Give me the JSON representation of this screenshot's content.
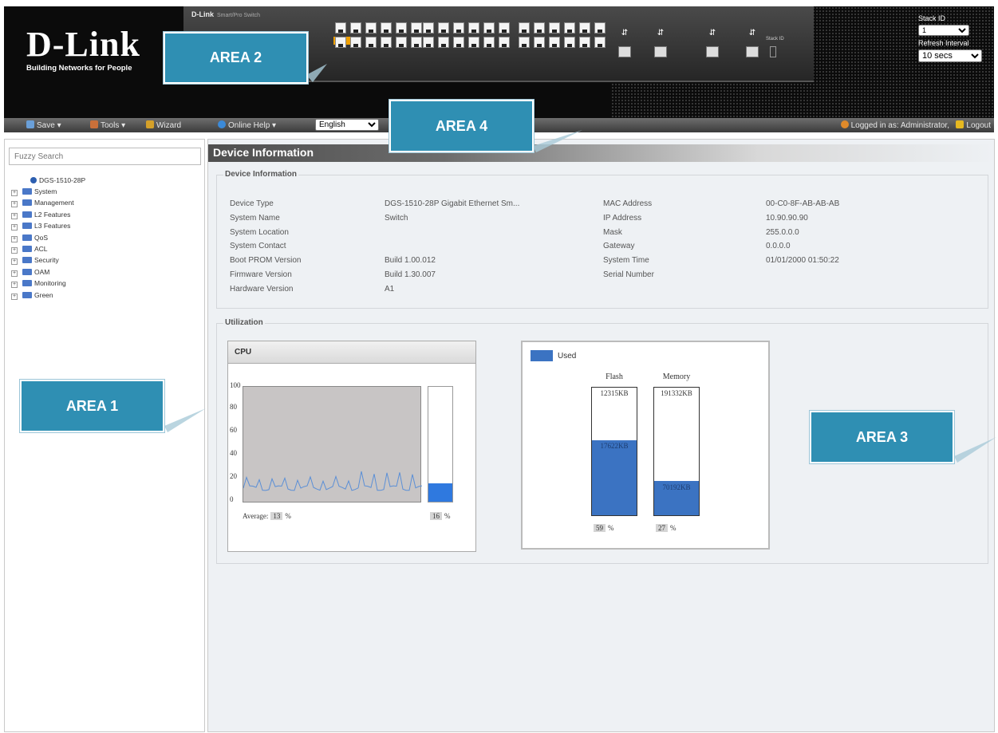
{
  "header": {
    "logo_text": "D-Link",
    "logo_tagline": "Building Networks for People",
    "panel_brand": "D-Link",
    "panel_sub": "Smart/Pro Switch",
    "stack_id_label": "Stack ID",
    "stack_id_value": "1",
    "refresh_label": "Refresh Interval",
    "refresh_value": "10 secs",
    "stack_mini_label": "Stack ID"
  },
  "toolbar": {
    "save": "Save ▾",
    "tools": "Tools ▾",
    "wizard": "Wizard",
    "online_help": "Online Help ▾",
    "language": "English",
    "logged_in": "Logged in as: Administrator,",
    "logout": "Logout"
  },
  "sidebar": {
    "search_placeholder": "Fuzzy Search",
    "root": "DGS-1510-28P",
    "items": [
      "System",
      "Management",
      "L2 Features",
      "L3 Features",
      "QoS",
      "ACL",
      "Security",
      "OAM",
      "Monitoring",
      "Green"
    ]
  },
  "main": {
    "title": "Device Information",
    "section_info": "Device Information",
    "section_util": "Utilization",
    "left_rows": [
      {
        "label": "Device Type",
        "value": "DGS-1510-28P Gigabit Ethernet Sm..."
      },
      {
        "label": "System Name",
        "value": "Switch"
      },
      {
        "label": "System Location",
        "value": ""
      },
      {
        "label": "System Contact",
        "value": ""
      },
      {
        "label": "Boot PROM Version",
        "value": "Build 1.00.012"
      },
      {
        "label": "Firmware Version",
        "value": "Build 1.30.007"
      },
      {
        "label": "Hardware Version",
        "value": "A1"
      }
    ],
    "right_rows": [
      {
        "label": "MAC Address",
        "value": "00-C0-8F-AB-AB-AB"
      },
      {
        "label": "IP Address",
        "value": "10.90.90.90"
      },
      {
        "label": "Mask",
        "value": "255.0.0.0"
      },
      {
        "label": "Gateway",
        "value": "0.0.0.0"
      },
      {
        "label": "System Time",
        "value": "01/01/2000 01:50:22"
      },
      {
        "label": "Serial Number",
        "value": ""
      }
    ]
  },
  "cpu": {
    "title": "CPU",
    "axis": [
      "100",
      "80",
      "60",
      "40",
      "20",
      "0"
    ],
    "average_label": "Average:",
    "average_value": "13",
    "current_value": "16",
    "percent_sign": "%",
    "current_fraction": 0.16,
    "trend_color": "#5b8fd6",
    "bar_color": "#2f79df"
  },
  "memory": {
    "legend": "Used",
    "used_color": "#3b73c2",
    "columns": [
      {
        "title": "Flash",
        "free": "12315KB",
        "used": "17622KB",
        "percent": "59",
        "fraction": 0.59
      },
      {
        "title": "Memory",
        "free": "191332KB",
        "used": "70192KB",
        "percent": "27",
        "fraction": 0.27
      }
    ],
    "percent_sign": "%"
  },
  "callouts": {
    "area1": "AREA 1",
    "area2": "AREA 2",
    "area3": "AREA 3",
    "area4": "AREA 4"
  }
}
